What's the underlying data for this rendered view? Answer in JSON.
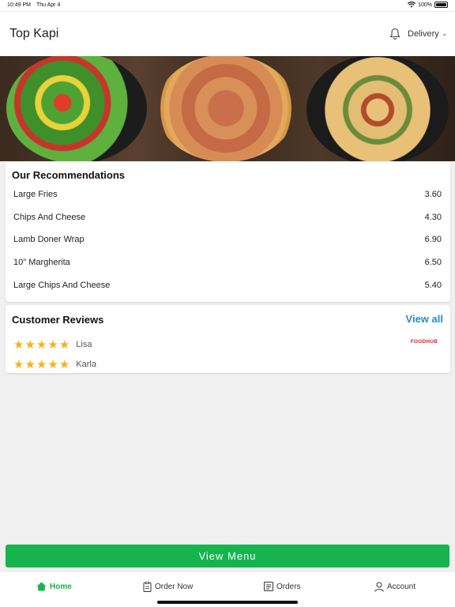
{
  "status_bar": {
    "time": "10:49 PM",
    "date": "Thu Apr 4",
    "battery": "100%",
    "icons": [
      "wifi-icon",
      "battery-icon"
    ]
  },
  "header": {
    "title": "Top Kapi",
    "delivery_label": "Delivery",
    "icons": [
      "bell-icon",
      "chevron-down-icon"
    ]
  },
  "hero": {
    "images": [
      "salad-plate",
      "pizza",
      "pasta-plate"
    ]
  },
  "recommendations": {
    "title": "Our Recommendations",
    "items": [
      {
        "name": "Large Fries",
        "price": "3.60"
      },
      {
        "name": "Chips And Cheese",
        "price": "4.30"
      },
      {
        "name": "Lamb Doner Wrap",
        "price": "6.90"
      },
      {
        "name": "10\" Margherita",
        "price": "6.50"
      },
      {
        "name": "Large Chips And Cheese",
        "price": "5.40"
      }
    ]
  },
  "reviews": {
    "title": "Customer Reviews",
    "view_all": "View all",
    "source_logo": "FOODHUB",
    "items": [
      {
        "name": "Lisa",
        "rating": 5
      },
      {
        "name": "Karla",
        "rating": 5
      }
    ]
  },
  "view_menu_label": "View Menu",
  "tabs": [
    {
      "label": "Home",
      "icon": "home-icon",
      "active": true
    },
    {
      "label": "Order Now",
      "icon": "order-icon",
      "active": false
    },
    {
      "label": "Orders",
      "icon": "orders-list-icon",
      "active": false
    },
    {
      "label": "Account",
      "icon": "user-icon",
      "active": false
    }
  ],
  "colors": {
    "accent": "#16b44d",
    "link": "#2a8ac4",
    "star": "#f2b318",
    "logo": "#d11f2f"
  }
}
